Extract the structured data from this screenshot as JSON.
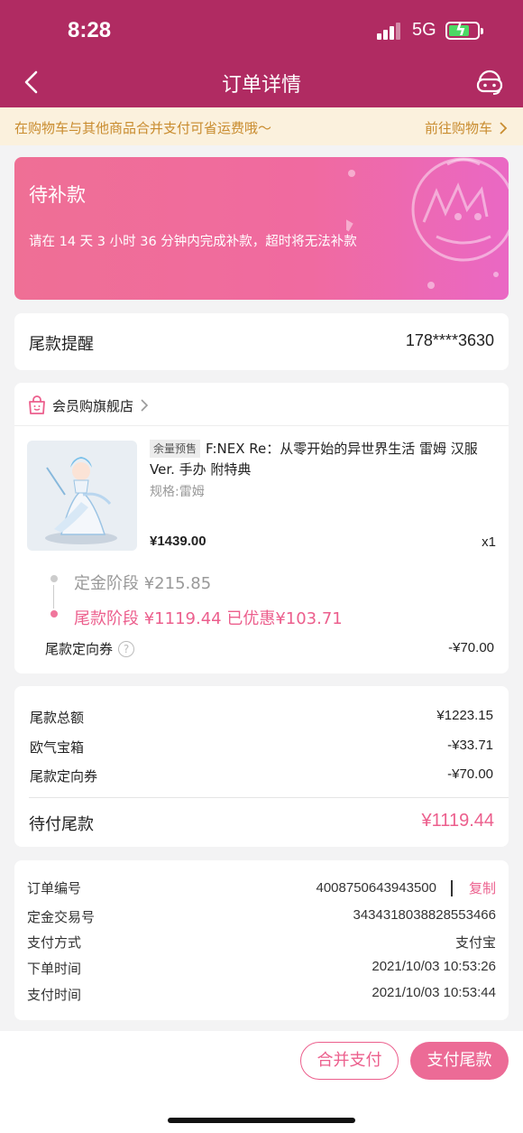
{
  "status_bar": {
    "time": "8:28",
    "network": "5G"
  },
  "nav": {
    "title": "订单详情",
    "back_icon": "chevron-left-icon",
    "service_icon": "customer-service-icon"
  },
  "promo": {
    "message": "在购物车与其他商品合并支付可省运费哦～",
    "link_label": "前往购物车"
  },
  "banner": {
    "status": "待补款",
    "description": "请在 14 天 3 小时 36 分钟内完成补款，超时将无法补款"
  },
  "reminder": {
    "label": "尾款提醒",
    "phone": "178****3630"
  },
  "order": {
    "shop_name": "会员购旗舰店",
    "product_tag": "余量预售",
    "product_title": "F:NEX Re：从零开始的异世界生活 雷姆 汉服Ver. 手办 附特典",
    "spec": "规格:雷姆",
    "price": "¥1439.00",
    "quantity": "x1",
    "stage_deposit": "定金阶段 ¥215.85",
    "stage_final": "尾款阶段 ¥1119.44 已优惠¥103.71",
    "coupon_label": "尾款定向券",
    "coupon_value": "-¥70.00"
  },
  "summary": {
    "rows": [
      {
        "label": "尾款总额",
        "value": "¥1223.15"
      },
      {
        "label": "欧气宝箱",
        "value": "-¥33.71"
      },
      {
        "label": "尾款定向券",
        "value": "-¥70.00"
      }
    ],
    "total_label": "待付尾款",
    "total_value": "¥1119.44"
  },
  "info": {
    "order_no_label": "订单编号",
    "order_no": "4008750643943500",
    "copy_label": "复制",
    "deposit_tx_label": "定金交易号",
    "deposit_tx": "3434318038828553466",
    "pay_method_label": "支付方式",
    "pay_method": "支付宝",
    "order_time_label": "下单时间",
    "order_time": "2021/10/03 10:53:26",
    "pay_time_label": "支付时间",
    "pay_time": "2021/10/03 10:53:44"
  },
  "actions": {
    "merge_pay": "合并支付",
    "pay_final": "支付尾款"
  },
  "colors": {
    "brand": "#b02b62",
    "accent": "#ec5f8d",
    "promo_text": "#c98c2f"
  }
}
